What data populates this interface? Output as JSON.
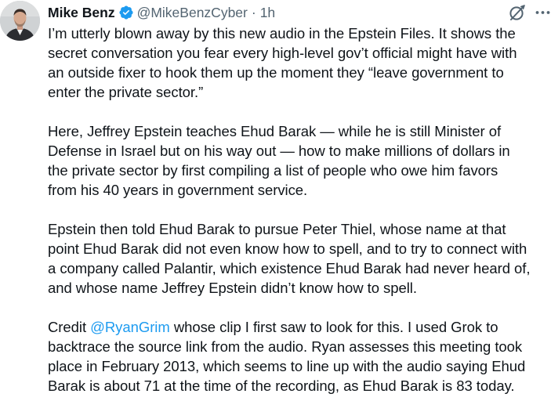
{
  "author": {
    "display_name": "Mike Benz",
    "handle": "@MikeBenzCyber",
    "separator": "·",
    "time": "1h",
    "verified_color": "#1d9bf0",
    "avatar_icon": "person-photo-avatar"
  },
  "actions": {
    "grok_icon": "grok-icon",
    "more_icon": "more-horizontal-icon"
  },
  "tweet": {
    "p1": [
      "I’m utterly blown away by this new audio in the Epstein Files. It shows the",
      "secret conversation you fear every high-level gov’t official might have with",
      "an outside fixer to hook them up the moment they “leave government to",
      "enter the private sector.”"
    ],
    "p2": [
      "Here, Jeffrey Epstein teaches Ehud Barak — while he is still Minister of",
      "Defense in Israel but on his way out — how to make millions of dollars in",
      "the private sector by first compiling a list of people who owe him favors",
      "from his 40 years in government service."
    ],
    "p3": [
      "Epstein then told Ehud Barak to pursue Peter Thiel, whose name at that",
      "point Ehud Barak did not even know how to spell, and to try to connect with",
      "a company called Palantir, which existence Ehud Barak had never heard of,",
      "and whose name Jeffrey Epstein didn’t know how to spell."
    ],
    "p4": {
      "line1_pre": "Credit ",
      "mention": "@RyanGrim",
      "line1_post": " whose clip I first saw to look for this. I used Grok to",
      "lines": [
        "backtrace the source link from the audio. Ryan assesses this meeting took",
        "place in February 2013, which seems to line up with the audio saying Ehud",
        "Barak is about 71 at the time of the recording, as Ehud Barak is 83 today."
      ]
    }
  }
}
